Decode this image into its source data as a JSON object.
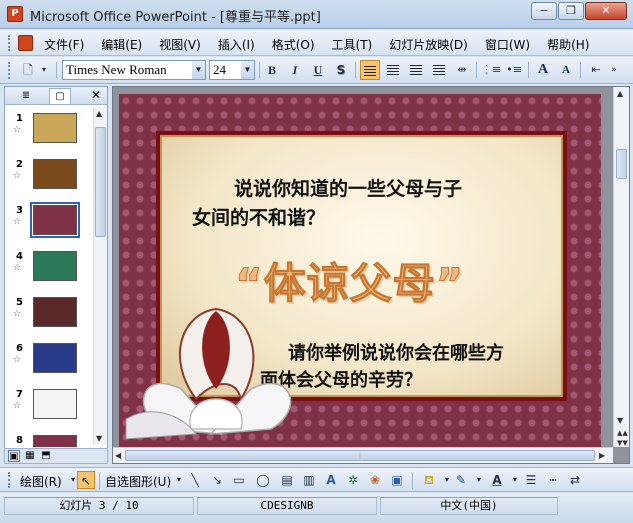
{
  "window": {
    "title": "Microsoft Office PowerPoint - [尊重与平等.ppt]",
    "minimize": "−",
    "restore": "❐",
    "close": "✕"
  },
  "menu": [
    "文件(F)",
    "编辑(E)",
    "视图(V)",
    "插入(I)",
    "格式(O)",
    "工具(T)",
    "幻灯片放映(D)",
    "窗口(W)",
    "帮助(H)"
  ],
  "toolbar": {
    "font_name": "Times New Roman",
    "font_size": "24",
    "bold": "B",
    "italic": "I",
    "underline": "U",
    "shadow": "S",
    "grow": "A",
    "shrink": "A"
  },
  "left_pane": {
    "slides": [
      {
        "num": "1",
        "thumb_color": "#c9a85a"
      },
      {
        "num": "2",
        "thumb_color": "#7a4a1a"
      },
      {
        "num": "3",
        "thumb_color": "#7e3147"
      },
      {
        "num": "4",
        "thumb_color": "#2a7a5a"
      },
      {
        "num": "5",
        "thumb_color": "#5a2a2a"
      },
      {
        "num": "6",
        "thumb_color": "#2a3a8a"
      },
      {
        "num": "7",
        "thumb_color": "#f4f4f4"
      },
      {
        "num": "8",
        "thumb_color": "#7e3147"
      }
    ],
    "close": "✕"
  },
  "slide": {
    "q1_line1": "说说你知道的一些父母与子",
    "q1_line2": "女间的不和谐？",
    "wordart": "“体谅父母”",
    "q2_line1": "请你举例说说你会在哪些方",
    "q2_line2": "面体会父母的辛劳？"
  },
  "drawbar": {
    "draw_label": "绘图(R)",
    "autoshapes_label": "自选图形(U)"
  },
  "status": {
    "slide_info": "幻灯片 3 / 10",
    "design": "CDESIGNB",
    "language": "中文(中国)"
  }
}
